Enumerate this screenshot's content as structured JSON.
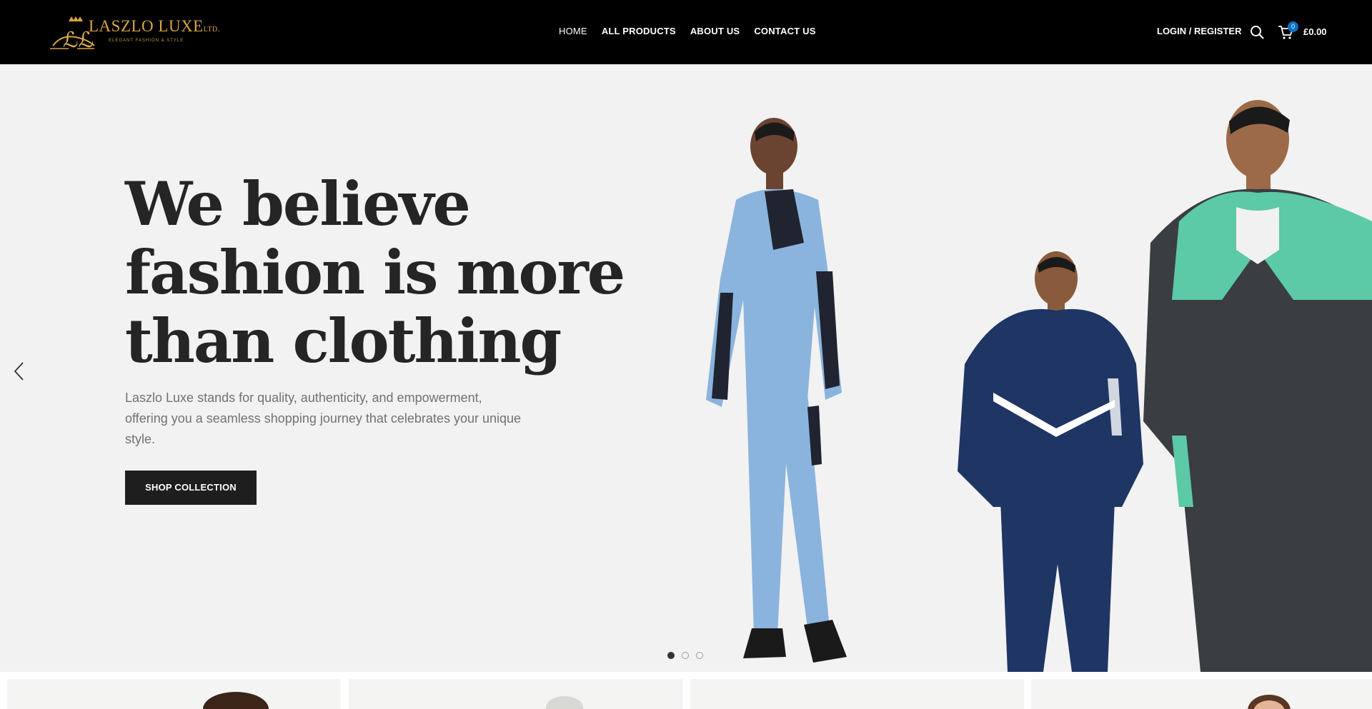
{
  "header": {
    "logo": {
      "brand": "LASZLO LUXE",
      "suffix": "LTD.",
      "tagline": "ELEGANT FASHION & STYLE",
      "monogram": "LL"
    },
    "nav": [
      {
        "label": "HOME",
        "active": true
      },
      {
        "label": "ALL PRODUCTS",
        "active": false
      },
      {
        "label": "ABOUT US",
        "active": false
      },
      {
        "label": "CONTACT US",
        "active": false
      }
    ],
    "login_label": "LOGIN / REGISTER",
    "search_icon": "search-icon",
    "cart_icon": "cart-icon",
    "cart_count": "0",
    "cart_total": "£0.00"
  },
  "hero": {
    "headline_lines": [
      "We believe",
      "fashion is more",
      "than clothing"
    ],
    "description": "Laszlo Luxe stands for quality, authenticity, and empowerment, offering you a seamless shopping journey that celebrates your unique style.",
    "cta_label": "SHOP COLLECTION",
    "prev_icon": "chevron-left-icon",
    "next_icon": "chevron-right-icon",
    "slide_count": 3,
    "active_slide": 1
  },
  "colors": {
    "header_bg": "#000000",
    "hero_bg": "#f2f2f2",
    "headline": "#252525",
    "body_text": "#727272",
    "button_bg": "#1e1e1e",
    "logo_gold": "#d9a441",
    "badge_blue": "#0a72c4"
  }
}
